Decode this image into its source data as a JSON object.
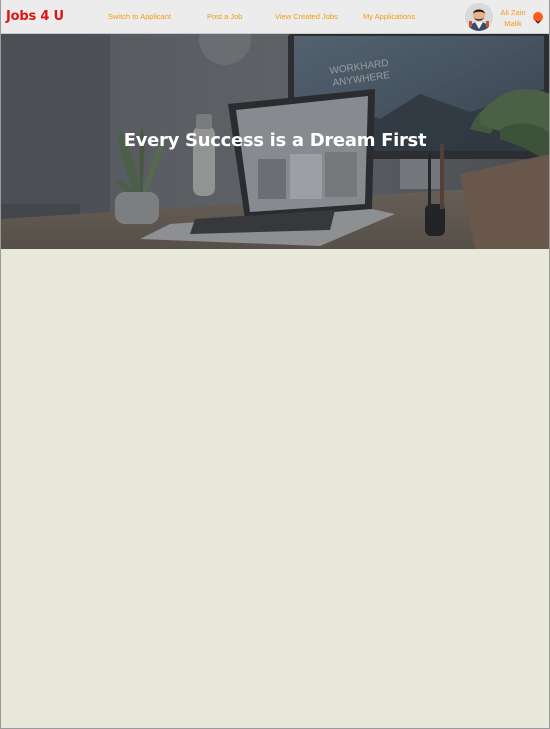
{
  "navbar": {
    "brand": "Jobs 4 U",
    "links": [
      {
        "label": "Switch to Applicant"
      },
      {
        "label": "Post a Job"
      },
      {
        "label": "View Created Jobs"
      },
      {
        "label": "My Applications"
      }
    ],
    "user": {
      "name": "Ali Zain Malik",
      "avatar_icon": "user-avatar-icon",
      "dropdown_icon": "chevron-down-icon"
    }
  },
  "hero": {
    "title": "Every Success is a Dream First",
    "background_image_desc_icon": "desk-workspace-image"
  },
  "colors": {
    "brand": "#e01414",
    "nav_link": "#f59a14",
    "dropdown": "#ff5a1f",
    "page_background": "#e8e8db",
    "navbar_background": "#ececec"
  }
}
